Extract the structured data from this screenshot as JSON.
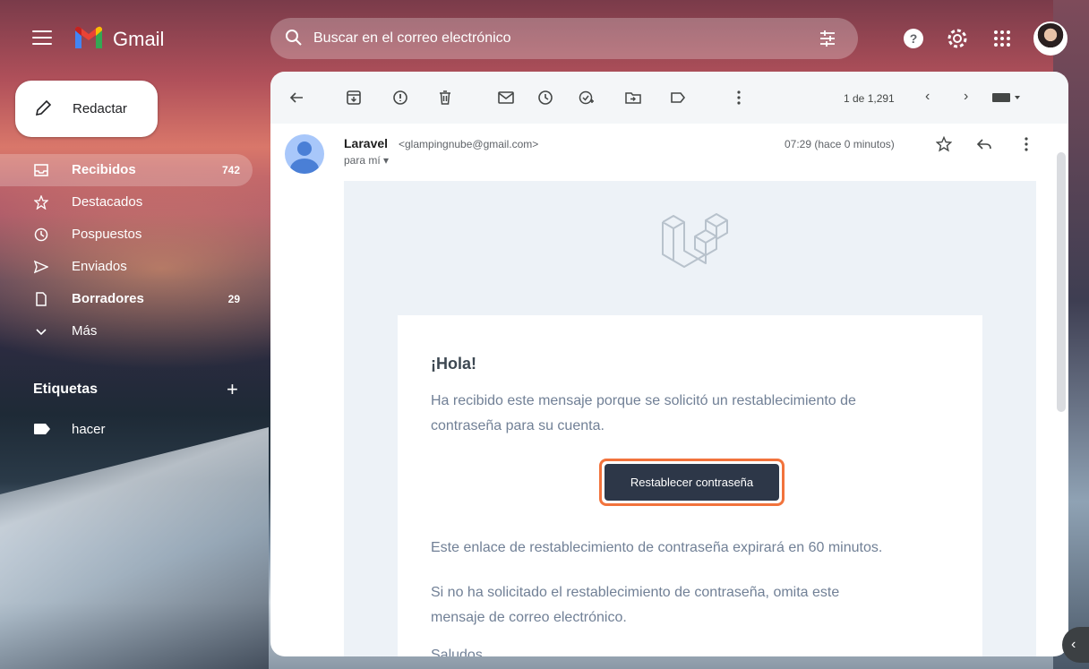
{
  "app": {
    "name": "Gmail"
  },
  "search": {
    "placeholder": "Buscar en el correo electrónico"
  },
  "compose": {
    "label": "Redactar"
  },
  "sidebar": {
    "items": [
      {
        "label": "Recibidos",
        "count": "742",
        "icon": "inbox-icon",
        "active": true,
        "bold": true
      },
      {
        "label": "Destacados",
        "count": "",
        "icon": "star-icon"
      },
      {
        "label": "Pospuestos",
        "count": "",
        "icon": "clock-icon"
      },
      {
        "label": "Enviados",
        "count": "",
        "icon": "send-icon"
      },
      {
        "label": "Borradores",
        "count": "29",
        "icon": "draft-icon",
        "bold": true
      },
      {
        "label": "Más",
        "count": "",
        "icon": "chevron-down-icon"
      }
    ],
    "labels_title": "Etiquetas",
    "labels_add": "+",
    "labels": [
      {
        "label": "hacer"
      }
    ]
  },
  "toolbar": {
    "pager": "1 de 1,291",
    "prev": "‹",
    "next": "›"
  },
  "message": {
    "sender_name": "Laravel",
    "sender_email": "<glampingnube@gmail.com>",
    "recipient": "para mí ▾",
    "time": "07:29 (hace 0 minutos)"
  },
  "email": {
    "greeting": "¡Hola!",
    "intro_line1": "Ha recibido este mensaje porque se solicitó un restablecimiento de",
    "intro_line2": "contraseña para su cuenta.",
    "button": "Restablecer contraseña",
    "expire": "Este enlace de restablecimiento de contraseña expirará en 60 minutos.",
    "ignore_line1": "Si no ha solicitado el restablecimiento de contraseña, omita este",
    "ignore_line2": "mensaje de correo electrónico.",
    "closing": "Saludos,"
  },
  "side_toggle": "‹",
  "colors": {
    "button_bg": "#2d3748",
    "button_highlight": "#f2733c",
    "body_bg": "#edf2f7",
    "text_muted": "#718096"
  }
}
